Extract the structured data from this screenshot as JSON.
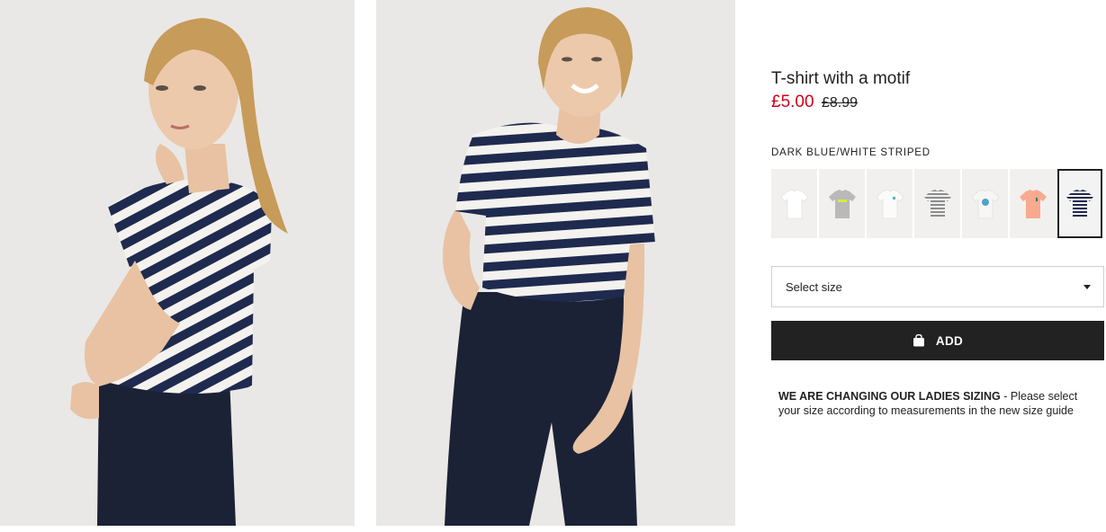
{
  "product": {
    "title": "T-shirt with a motif",
    "price_sale": "£5.00",
    "price_original": "£8.99",
    "color_name": "DARK BLUE/WHITE STRIPED"
  },
  "swatches": [
    {
      "name": "white",
      "color": "#ffffff",
      "selected": false
    },
    {
      "name": "grey-print",
      "color": "#b9b9b9",
      "selected": false
    },
    {
      "name": "white-print",
      "color": "#fbfbfb",
      "selected": false
    },
    {
      "name": "grey-striped",
      "color": "#9a9a9a",
      "selected": false
    },
    {
      "name": "white-floral",
      "color": "#f6f6f6",
      "selected": false
    },
    {
      "name": "peach",
      "color": "#f9a98e",
      "selected": false
    },
    {
      "name": "dark-blue-white-striped",
      "color": "#1f2a4f",
      "selected": true
    }
  ],
  "size_select": {
    "label": "Select size",
    "icon": "chevron-down-icon"
  },
  "add_button": {
    "label": "ADD",
    "icon": "shopping-bag-icon"
  },
  "notice": {
    "bold": "WE ARE CHANGING OUR LADIES SIZING",
    "text": " - Please select your size according to measurements in the new size guide"
  },
  "colors": {
    "sale_red": "#d0021b",
    "button_black": "#222222",
    "stripe_navy": "#1f2a4f"
  }
}
